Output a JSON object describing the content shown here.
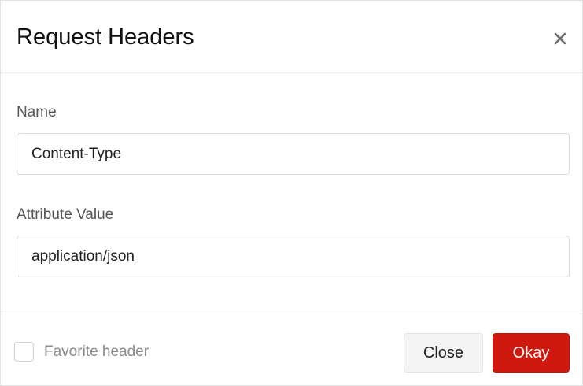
{
  "dialog": {
    "title": "Request Headers",
    "close_icon": "close-x-icon"
  },
  "fields": {
    "name": {
      "label": "Name",
      "value": "Content-Type"
    },
    "attribute_value": {
      "label": "Attribute Value",
      "value": "application/json"
    }
  },
  "footer": {
    "favorite_label": "Favorite header",
    "favorite_checked": false,
    "close_label": "Close",
    "okay_label": "Okay"
  },
  "colors": {
    "primary": "#d0190e",
    "secondary_button_bg": "#f4f4f4"
  }
}
